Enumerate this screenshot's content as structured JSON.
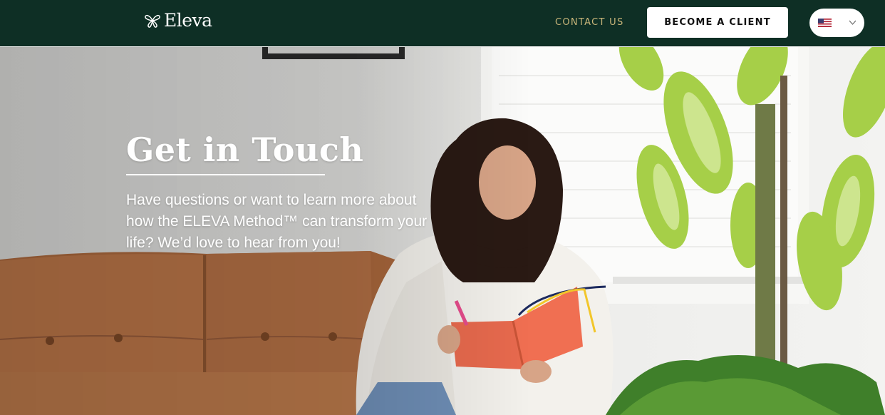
{
  "header": {
    "logo_text": "Eleva",
    "contact_label": "CONTACT US",
    "cta_label": "BECOME A CLIENT",
    "language": {
      "flag": "us-flag-icon",
      "dropdown_icon": "chevron-down-icon"
    }
  },
  "hero": {
    "title": "Get in Touch",
    "description": "Have questions or want to learn more about how the ELEVA Method™ can transform your life? We’d love to hear from you!"
  },
  "colors": {
    "header_bg": "#0e2f25",
    "accent_gold": "#c9b67a",
    "button_bg": "#ffffff",
    "hero_text": "#ffffff"
  }
}
